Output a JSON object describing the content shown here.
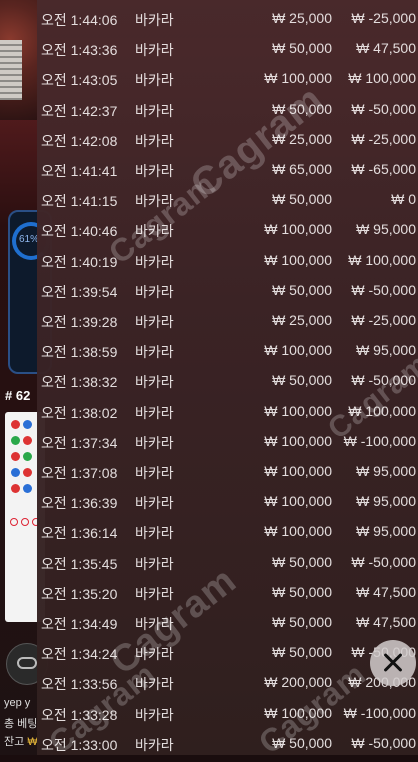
{
  "background": {
    "progress_percent_label": "61%",
    "round_label": "# 62",
    "user_label": "yep y",
    "bet_label": "총 베팅",
    "balance_label": "잔고",
    "balance_currency": "₩"
  },
  "history": {
    "rows": [
      {
        "time": "오전 1:44:06",
        "game": "바카라",
        "bet": "₩ 25,000",
        "result": "₩ -25,000"
      },
      {
        "time": "오전 1:43:36",
        "game": "바카라",
        "bet": "₩ 50,000",
        "result": "₩ 47,500"
      },
      {
        "time": "오전 1:43:05",
        "game": "바카라",
        "bet": "₩ 100,000",
        "result": "₩ 100,000"
      },
      {
        "time": "오전 1:42:37",
        "game": "바카라",
        "bet": "₩ 50,000",
        "result": "₩ -50,000"
      },
      {
        "time": "오전 1:42:08",
        "game": "바카라",
        "bet": "₩ 25,000",
        "result": "₩ -25,000"
      },
      {
        "time": "오전 1:41:41",
        "game": "바카라",
        "bet": "₩ 65,000",
        "result": "₩ -65,000"
      },
      {
        "time": "오전 1:41:15",
        "game": "바카라",
        "bet": "₩ 50,000",
        "result": "₩ 0"
      },
      {
        "time": "오전 1:40:46",
        "game": "바카라",
        "bet": "₩ 100,000",
        "result": "₩ 95,000"
      },
      {
        "time": "오전 1:40:19",
        "game": "바카라",
        "bet": "₩ 100,000",
        "result": "₩ 100,000"
      },
      {
        "time": "오전 1:39:54",
        "game": "바카라",
        "bet": "₩ 50,000",
        "result": "₩ -50,000"
      },
      {
        "time": "오전 1:39:28",
        "game": "바카라",
        "bet": "₩ 25,000",
        "result": "₩ -25,000"
      },
      {
        "time": "오전 1:38:59",
        "game": "바카라",
        "bet": "₩ 100,000",
        "result": "₩ 95,000"
      },
      {
        "time": "오전 1:38:32",
        "game": "바카라",
        "bet": "₩ 50,000",
        "result": "₩ -50,000"
      },
      {
        "time": "오전 1:38:02",
        "game": "바카라",
        "bet": "₩ 100,000",
        "result": "₩ 100,000"
      },
      {
        "time": "오전 1:37:34",
        "game": "바카라",
        "bet": "₩ 100,000",
        "result": "₩ -100,000"
      },
      {
        "time": "오전 1:37:08",
        "game": "바카라",
        "bet": "₩ 100,000",
        "result": "₩ 95,000"
      },
      {
        "time": "오전 1:36:39",
        "game": "바카라",
        "bet": "₩ 100,000",
        "result": "₩ 95,000"
      },
      {
        "time": "오전 1:36:14",
        "game": "바카라",
        "bet": "₩ 100,000",
        "result": "₩ 95,000"
      },
      {
        "time": "오전 1:35:45",
        "game": "바카라",
        "bet": "₩ 50,000",
        "result": "₩ -50,000"
      },
      {
        "time": "오전 1:35:20",
        "game": "바카라",
        "bet": "₩ 50,000",
        "result": "₩ 47,500"
      },
      {
        "time": "오전 1:34:49",
        "game": "바카라",
        "bet": "₩ 50,000",
        "result": "₩ 47,500"
      },
      {
        "time": "오전 1:34:24",
        "game": "바카라",
        "bet": "₩ 50,000",
        "result": "₩ -50,000"
      },
      {
        "time": "오전 1:33:56",
        "game": "바카라",
        "bet": "₩ 200,000",
        "result": "₩ 200,000"
      },
      {
        "time": "오전 1:33:28",
        "game": "바카라",
        "bet": "₩ 100,000",
        "result": "₩ -100,000"
      },
      {
        "time": "오전 1:33:00",
        "game": "바카라",
        "bet": "₩ 50,000",
        "result": "₩ -50,000"
      }
    ]
  },
  "watermark_text": "Cagram",
  "icons": {
    "close": "close-icon",
    "chat": "chat-icon"
  }
}
